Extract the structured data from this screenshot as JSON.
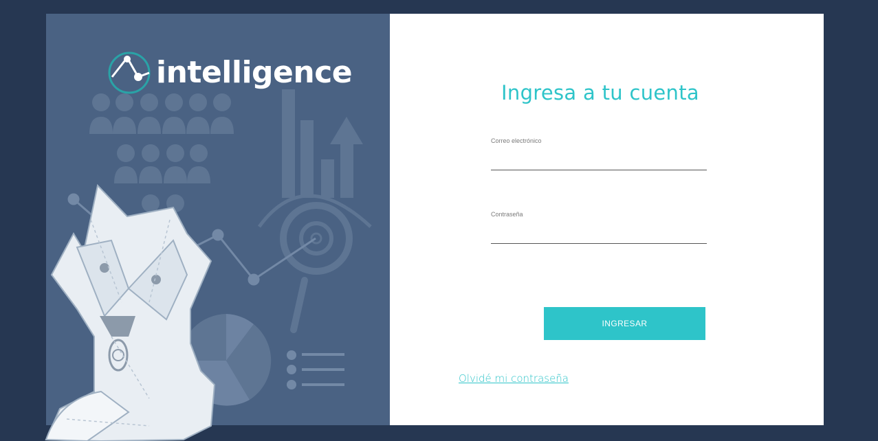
{
  "brand": {
    "name": "intelligence",
    "accent_color": "#2ec4c9",
    "background_color": "#263752",
    "panel_color": "#4a6283"
  },
  "login": {
    "title": "Ingresa a tu cuenta",
    "email_label": "Correo electrónico",
    "email_value": "",
    "password_label": "Contraseña",
    "password_value": "",
    "submit_label": "INGRESAR",
    "forgot_link": "Olvidé mi contraseña"
  },
  "illustration": {
    "mascot": "fox-mascot",
    "icons": [
      "people-icon",
      "bar-chart-icon",
      "magnifier-icon",
      "line-chart-icon",
      "pie-chart-icon",
      "list-icon"
    ]
  }
}
